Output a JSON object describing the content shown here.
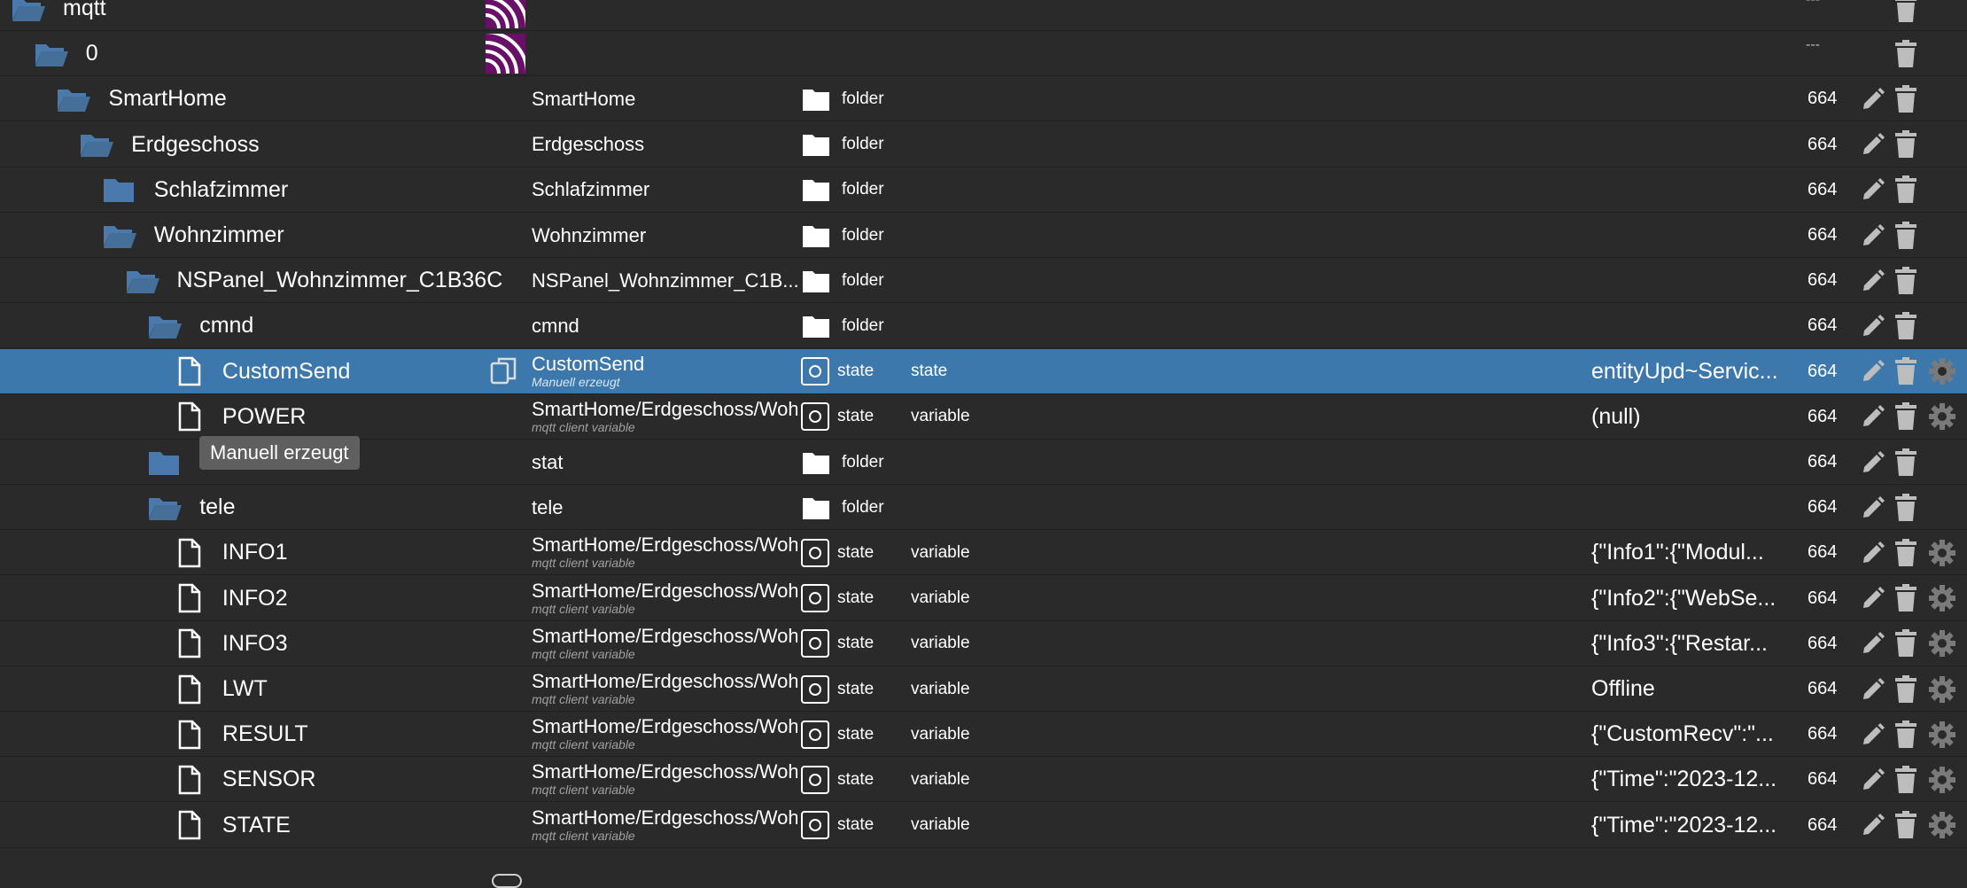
{
  "colors": {
    "background": "#2a2a2a",
    "selected_row": "#3d78ad",
    "folder_icon": "#4a7aad",
    "mqtt_logo": "#6a0f68",
    "action_icon": "#bdbdbd",
    "tooltip_bg": "#5f5f5f"
  },
  "tooltip": {
    "text": "Manuell erzeugt"
  },
  "rows": [
    {
      "name": "mqtt",
      "object_name": "",
      "sub": "",
      "type": "",
      "role": "",
      "value": "",
      "acl": "---",
      "kind": "folder-open",
      "level": 0,
      "logo": true,
      "edit": false,
      "gear": false,
      "selected": false
    },
    {
      "name": "0",
      "object_name": "",
      "sub": "",
      "type": "",
      "role": "",
      "value": "",
      "acl": "---",
      "kind": "folder-open",
      "level": 1,
      "logo": true,
      "edit": false,
      "gear": false,
      "selected": false
    },
    {
      "name": "SmartHome",
      "object_name": "SmartHome",
      "sub": "",
      "type": "folder",
      "role": "",
      "value": "",
      "acl": "664",
      "kind": "folder-open",
      "level": 2,
      "logo": false,
      "edit": true,
      "gear": false,
      "selected": false
    },
    {
      "name": "Erdgeschoss",
      "object_name": "Erdgeschoss",
      "sub": "",
      "type": "folder",
      "role": "",
      "value": "",
      "acl": "664",
      "kind": "folder-open",
      "level": 3,
      "logo": false,
      "edit": true,
      "gear": false,
      "selected": false
    },
    {
      "name": "Schlafzimmer",
      "object_name": "Schlafzimmer",
      "sub": "",
      "type": "folder",
      "role": "",
      "value": "",
      "acl": "664",
      "kind": "folder-closed",
      "level": 4,
      "logo": false,
      "edit": true,
      "gear": false,
      "selected": false
    },
    {
      "name": "Wohnzimmer",
      "object_name": "Wohnzimmer",
      "sub": "",
      "type": "folder",
      "role": "",
      "value": "",
      "acl": "664",
      "kind": "folder-open",
      "level": 4,
      "logo": false,
      "edit": true,
      "gear": false,
      "selected": false
    },
    {
      "name": "NSPanel_Wohnzimmer_C1B36C",
      "object_name": "NSPanel_Wohnzimmer_C1B...",
      "sub": "",
      "type": "folder",
      "role": "",
      "value": "",
      "acl": "664",
      "kind": "folder-open",
      "level": 5,
      "logo": false,
      "edit": true,
      "gear": false,
      "selected": false
    },
    {
      "name": "cmnd",
      "object_name": "cmnd",
      "sub": "",
      "type": "folder",
      "role": "",
      "value": "",
      "acl": "664",
      "kind": "folder-open",
      "level": 6,
      "logo": false,
      "edit": true,
      "gear": false,
      "selected": false
    },
    {
      "name": "CustomSend",
      "object_name": "CustomSend",
      "sub": "Manuell erzeugt",
      "type": "state",
      "role": "state",
      "value": "entityUpd~Servic...",
      "acl": "664",
      "kind": "file",
      "level": 7,
      "logo": false,
      "edit": true,
      "gear": true,
      "selected": true,
      "copy": true
    },
    {
      "name": "POWER",
      "object_name": "SmartHome/Erdgeschoss/Woh",
      "sub": "mqtt client variable",
      "type": "state",
      "role": "variable",
      "value": "(null)",
      "acl": "664",
      "kind": "file",
      "level": 7,
      "logo": false,
      "edit": true,
      "gear": true,
      "selected": false
    },
    {
      "name": "stat",
      "object_name": "stat",
      "sub": "",
      "type": "folder",
      "role": "",
      "value": "",
      "acl": "664",
      "kind": "folder-closed",
      "level": 6,
      "logo": false,
      "edit": true,
      "gear": false,
      "selected": false
    },
    {
      "name": "tele",
      "object_name": "tele",
      "sub": "",
      "type": "folder",
      "role": "",
      "value": "",
      "acl": "664",
      "kind": "folder-open",
      "level": 6,
      "logo": false,
      "edit": true,
      "gear": false,
      "selected": false
    },
    {
      "name": "INFO1",
      "object_name": "SmartHome/Erdgeschoss/Woh",
      "sub": "mqtt client variable",
      "type": "state",
      "role": "variable",
      "value": "{\"Info1\":{\"Modul...",
      "acl": "664",
      "kind": "file",
      "level": 7,
      "logo": false,
      "edit": true,
      "gear": true,
      "selected": false
    },
    {
      "name": "INFO2",
      "object_name": "SmartHome/Erdgeschoss/Woh",
      "sub": "mqtt client variable",
      "type": "state",
      "role": "variable",
      "value": "{\"Info2\":{\"WebSe...",
      "acl": "664",
      "kind": "file",
      "level": 7,
      "logo": false,
      "edit": true,
      "gear": true,
      "selected": false
    },
    {
      "name": "INFO3",
      "object_name": "SmartHome/Erdgeschoss/Woh",
      "sub": "mqtt client variable",
      "type": "state",
      "role": "variable",
      "value": "{\"Info3\":{\"Restar...",
      "acl": "664",
      "kind": "file",
      "level": 7,
      "logo": false,
      "edit": true,
      "gear": true,
      "selected": false
    },
    {
      "name": "LWT",
      "object_name": "SmartHome/Erdgeschoss/Woh",
      "sub": "mqtt client variable",
      "type": "state",
      "role": "variable",
      "value": "Offline",
      "acl": "664",
      "kind": "file",
      "level": 7,
      "logo": false,
      "edit": true,
      "gear": true,
      "selected": false
    },
    {
      "name": "RESULT",
      "object_name": "SmartHome/Erdgeschoss/Woh",
      "sub": "mqtt client variable",
      "type": "state",
      "role": "variable",
      "value": "{\"CustomRecv\":\"...",
      "acl": "664",
      "kind": "file",
      "level": 7,
      "logo": false,
      "edit": true,
      "gear": true,
      "selected": false
    },
    {
      "name": "SENSOR",
      "object_name": "SmartHome/Erdgeschoss/Woh",
      "sub": "mqtt client variable",
      "type": "state",
      "role": "variable",
      "value": "{\"Time\":\"2023-12...",
      "acl": "664",
      "kind": "file",
      "level": 7,
      "logo": false,
      "edit": true,
      "gear": true,
      "selected": false
    },
    {
      "name": "STATE",
      "object_name": "SmartHome/Erdgeschoss/Woh",
      "sub": "mqtt client variable",
      "type": "state",
      "role": "variable",
      "value": "{\"Time\":\"2023-12...",
      "acl": "664",
      "kind": "file",
      "level": 7,
      "logo": false,
      "edit": true,
      "gear": true,
      "selected": false
    }
  ]
}
